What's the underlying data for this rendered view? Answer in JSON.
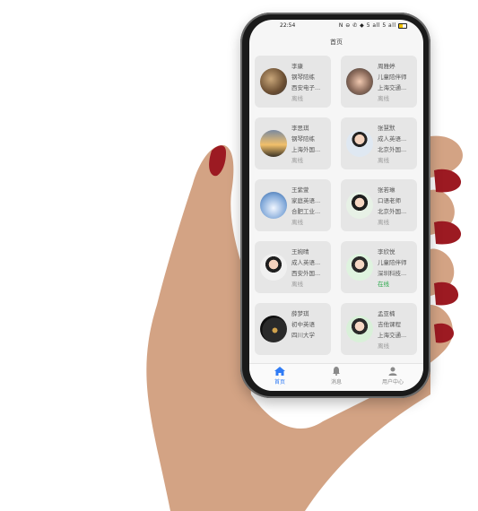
{
  "status_bar": {
    "time": "22:54",
    "icons_text": "N ⊖ ✆ ◆ 5 all 5 all"
  },
  "page_title": "首页",
  "contacts": [
    {
      "name": "李康",
      "role": "钢琴陪练",
      "school": "西安电子...",
      "status": "离线",
      "online": false,
      "avatar": "photo-library"
    },
    {
      "name": "周雅婷",
      "role": "儿童陪伴师",
      "school": "上海交通...",
      "status": "离线",
      "online": false,
      "avatar": "photo-group"
    },
    {
      "name": "李思琪",
      "role": "钢琴陪练",
      "school": "上海外国...",
      "status": "离线",
      "online": false,
      "avatar": "photo-sunset"
    },
    {
      "name": "张慧默",
      "role": "成人英语...",
      "school": "北京外国...",
      "status": "离线",
      "online": false,
      "avatar": "photo-boy"
    },
    {
      "name": "王紫萱",
      "role": "家庭英语...",
      "school": "合肥工业...",
      "status": "离线",
      "online": false,
      "avatar": "photo-sky"
    },
    {
      "name": "张若琳",
      "role": "口语老师",
      "school": "北京外国...",
      "status": "离线",
      "online": false,
      "avatar": "photo-girl"
    },
    {
      "name": "王婉晴",
      "role": "成人英语...",
      "school": "西安外国...",
      "status": "离线",
      "online": false,
      "avatar": "photo-girl"
    },
    {
      "name": "李欣悦",
      "role": "儿童陪伴师",
      "school": "深圳科技...",
      "status": "在线",
      "online": true,
      "avatar": "photo-girl-green"
    },
    {
      "name": "薛梦琪",
      "role": "初中英语",
      "school": "四川大学",
      "status": "",
      "online": false,
      "avatar": "photo-night"
    },
    {
      "name": "孟亚楠",
      "role": "吉他课程",
      "school": "上海交通...",
      "status": "离线",
      "online": false,
      "avatar": "photo-girl-green"
    }
  ],
  "tabs": [
    {
      "label": "首页",
      "icon": "home-icon",
      "active": true
    },
    {
      "label": "消息",
      "icon": "bell-icon",
      "active": false
    },
    {
      "label": "用户中心",
      "icon": "user-icon",
      "active": false
    }
  ],
  "colors": {
    "accent": "#2f7bf5",
    "online": "#2aa84a",
    "offline": "#999999",
    "card_bg": "#e6e6e6"
  }
}
